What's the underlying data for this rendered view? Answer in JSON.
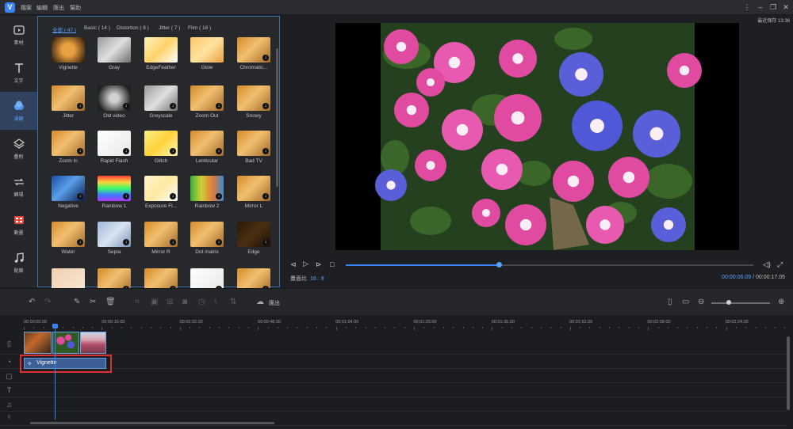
{
  "titlebar": {
    "menu": [
      "檔案",
      "編輯",
      "匯出",
      "幫助"
    ]
  },
  "preview": {
    "last_saved": "最近保存 13:36",
    "aspect_label": "畫面比",
    "aspect_value": "16 : 9",
    "time_current": "00:00:06.09",
    "time_separator": "/",
    "time_total": "00:00:17.05",
    "progress": 0.375
  },
  "leftnav": {
    "items": [
      {
        "label": "素材",
        "icon": "media-icon"
      },
      {
        "label": "文字",
        "icon": "text-icon"
      },
      {
        "label": "濾鏡",
        "icon": "filter-icon"
      },
      {
        "label": "疊附",
        "icon": "overlay-icon"
      },
      {
        "label": "轉場",
        "icon": "transition-icon"
      },
      {
        "label": "動畫",
        "icon": "animation-icon"
      },
      {
        "label": "配樂",
        "icon": "music-icon"
      }
    ],
    "active_index": 2
  },
  "filters": {
    "tabs": [
      "全部 ( 47 )",
      "Basic ( 14 )",
      "Distortion ( 8 )",
      "Jitter ( 7 )",
      "Film ( 18 )"
    ],
    "active_tab": 0,
    "items": [
      {
        "name": "Vignette",
        "dl": false,
        "style": "vignette"
      },
      {
        "name": "Gray",
        "dl": false,
        "style": "gray"
      },
      {
        "name": "EdgeFeather",
        "dl": false,
        "style": "bright"
      },
      {
        "name": "Glow",
        "dl": false,
        "style": "glow"
      },
      {
        "name": "Chromatic...",
        "dl": true,
        "style": "warm"
      },
      {
        "name": "Jitter",
        "dl": true,
        "style": "warm"
      },
      {
        "name": "Old video",
        "dl": true,
        "style": "oldvideo"
      },
      {
        "name": "Greyscale",
        "dl": true,
        "style": "gray"
      },
      {
        "name": "Zoom Out",
        "dl": true,
        "style": "warm"
      },
      {
        "name": "Snowy",
        "dl": true,
        "style": "warm"
      },
      {
        "name": "Zoom In",
        "dl": true,
        "style": "warm"
      },
      {
        "name": "Rapid Flash",
        "dl": true,
        "style": "white"
      },
      {
        "name": "Glitch",
        "dl": true,
        "style": "yellow"
      },
      {
        "name": "Lenticular",
        "dl": true,
        "style": "warm"
      },
      {
        "name": "Bad TV",
        "dl": true,
        "style": "warm"
      },
      {
        "name": "Negative",
        "dl": true,
        "style": "negative"
      },
      {
        "name": "Rainbow 1",
        "dl": true,
        "style": "rainbow"
      },
      {
        "name": "Exposure Fl...",
        "dl": true,
        "style": "exposure"
      },
      {
        "name": "Rainbow 2",
        "dl": true,
        "style": "rainbow2"
      },
      {
        "name": "Mirror L",
        "dl": true,
        "style": "warm"
      },
      {
        "name": "Water",
        "dl": true,
        "style": "warm"
      },
      {
        "name": "Sepia",
        "dl": true,
        "style": "sepia"
      },
      {
        "name": "Mirror R",
        "dl": true,
        "style": "warm"
      },
      {
        "name": "Dot matrix",
        "dl": true,
        "style": "warm"
      },
      {
        "name": "Edge",
        "dl": true,
        "style": "edge"
      },
      {
        "name": "",
        "dl": false,
        "style": "pale"
      },
      {
        "name": "",
        "dl": true,
        "style": "warm"
      },
      {
        "name": "",
        "dl": true,
        "style": "warm"
      },
      {
        "name": "",
        "dl": true,
        "style": "white"
      },
      {
        "name": "",
        "dl": true,
        "style": "warm"
      }
    ]
  },
  "toolbar": {
    "export_label": "匯出"
  },
  "timeline": {
    "ticks": [
      "00:00:00.00",
      "00:00:16.00",
      "00:00:32.00",
      "00:00:48.00",
      "00:01:04.00",
      "00:01:20.00",
      "00:01:36.00",
      "00:01:52.00",
      "00:02:08.00",
      "00:02:24.00"
    ],
    "filter_clip_label": "Vignette"
  },
  "colors": {
    "accent": "#3b82f6",
    "highlight_box": "#e03030"
  }
}
